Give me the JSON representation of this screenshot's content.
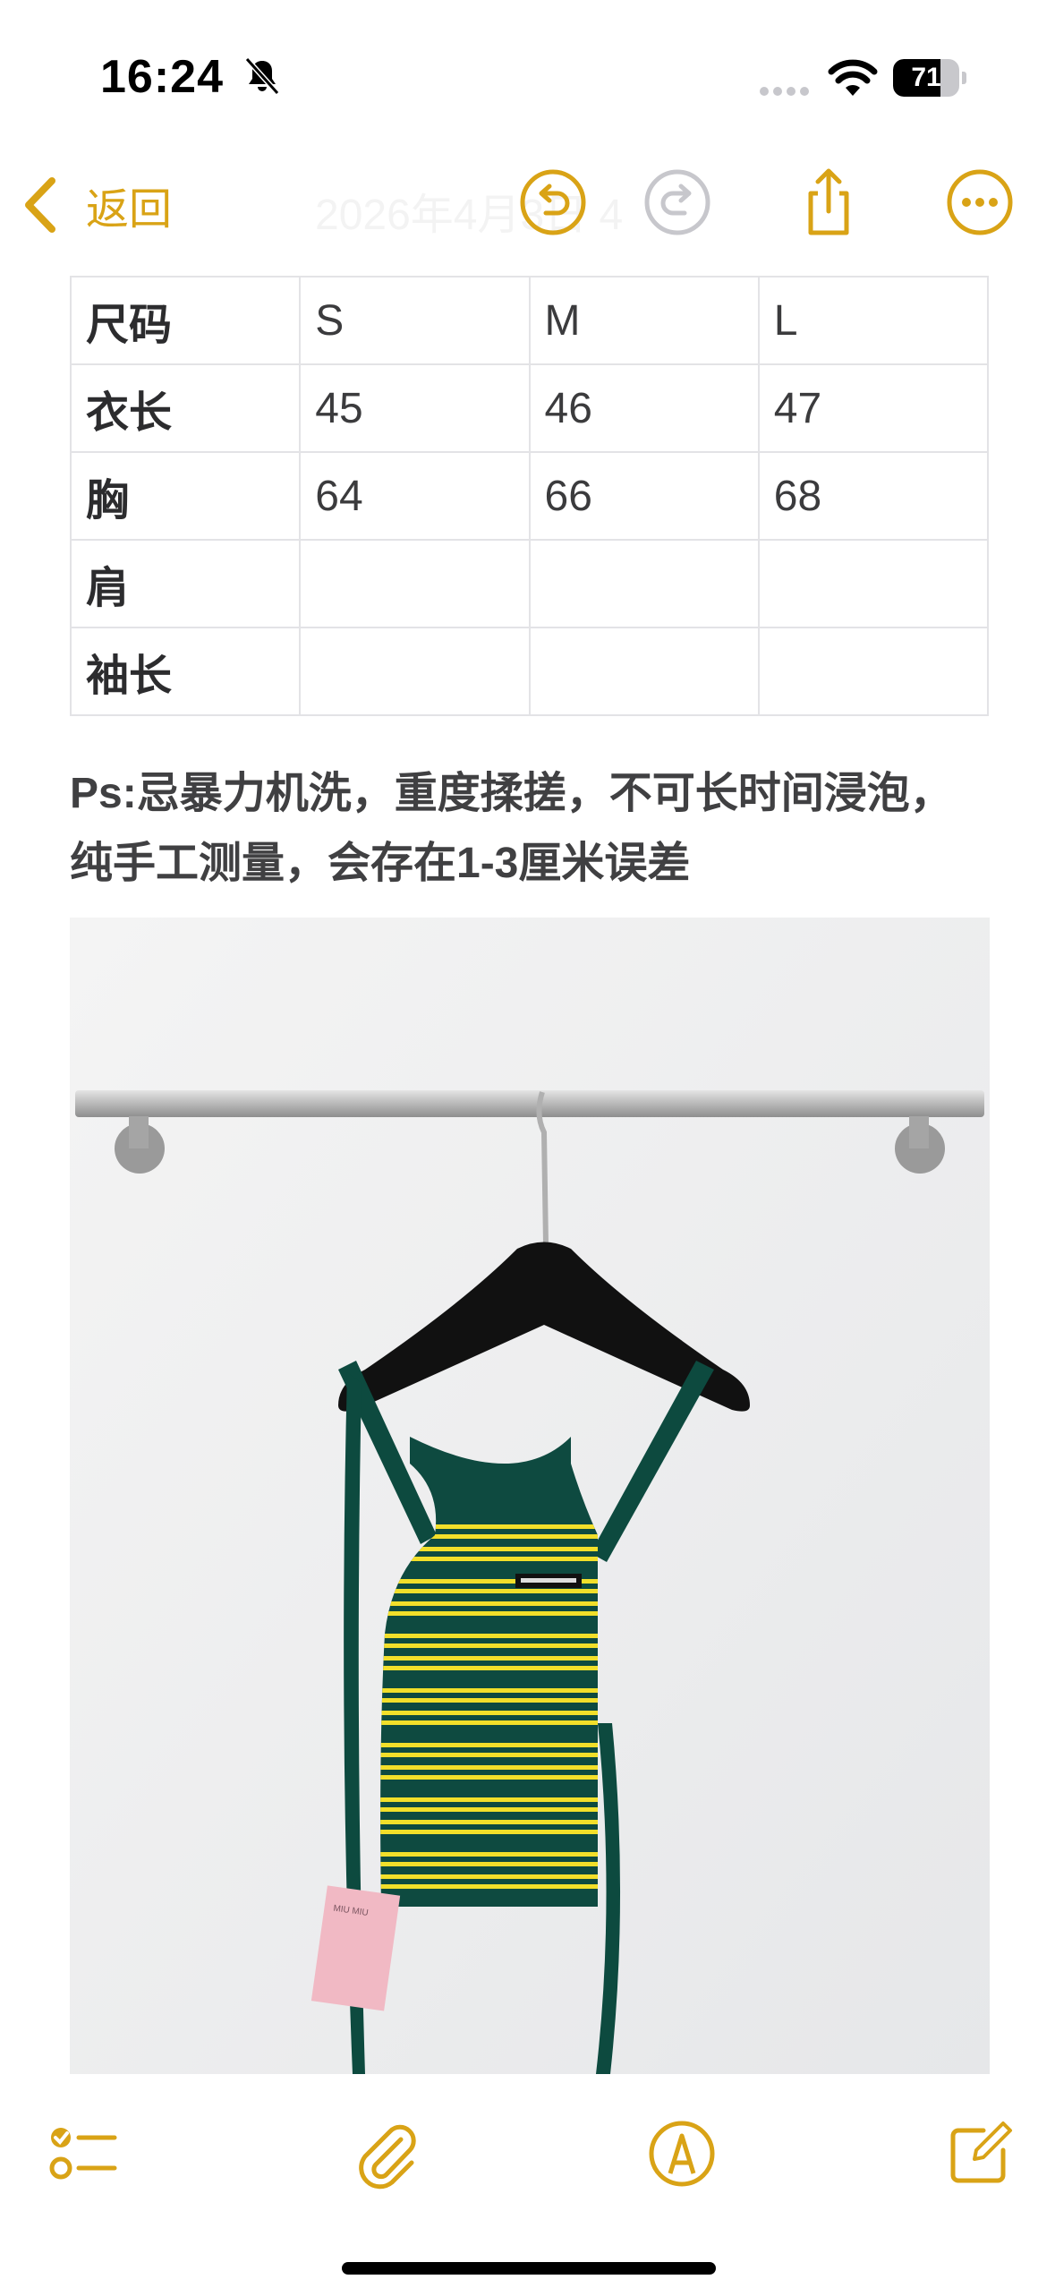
{
  "status_bar": {
    "time": "16:24",
    "battery_level": "71",
    "battery_fraction": 0.71,
    "icons": [
      "bell-slash-icon",
      "cellular-signal-icon",
      "wifi-icon",
      "battery-icon"
    ]
  },
  "nav": {
    "back_label": "返回",
    "date_label": "2026年4月3日 4",
    "icons": [
      "chevron-left-icon",
      "undo-icon",
      "redo-icon",
      "share-icon",
      "more-icon"
    ],
    "accent_color": "#d9a316"
  },
  "size_table": {
    "header": [
      "尺码",
      "S",
      "M",
      "L"
    ],
    "rows": [
      [
        "衣长",
        "45",
        "46",
        "47"
      ],
      [
        "胸",
        "64",
        "66",
        "68"
      ],
      [
        "肩",
        "",
        "",
        ""
      ],
      [
        "袖长",
        "",
        "",
        ""
      ]
    ]
  },
  "note": {
    "text": "Ps:忌暴力机洗，重度揉搓，不可长时间浸泡，纯手工测量，会存在1-3厘米误差"
  },
  "photo": {
    "subject": "green and yellow striped knit camisole on hanger",
    "tag_text": "MIU MIU"
  },
  "toolbar": {
    "icons": [
      "checklist-icon",
      "paperclip-icon",
      "markup-pen-icon",
      "compose-icon"
    ]
  }
}
